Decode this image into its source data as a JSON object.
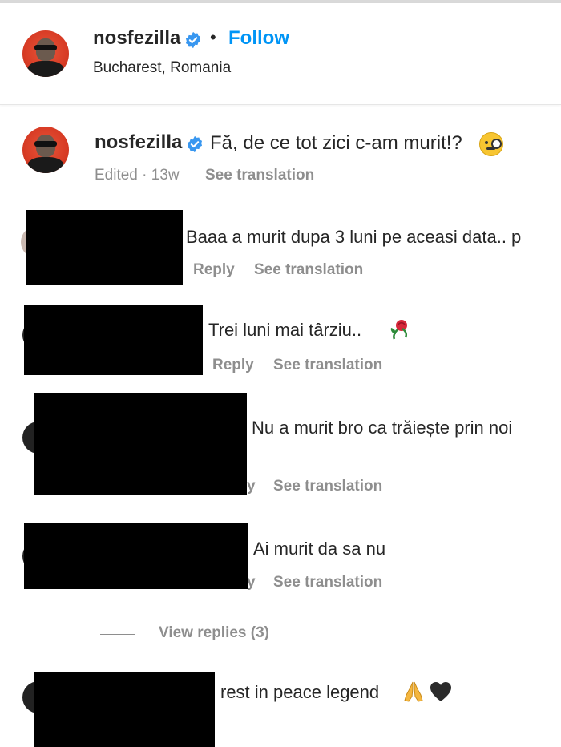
{
  "header": {
    "username": "nosfezilla",
    "separator": "•",
    "follow_label": "Follow",
    "location": "Bucharest, Romania"
  },
  "caption": {
    "username": "nosfezilla",
    "text": "Fă, de ce tot zici c-am murit!?",
    "edited_time": "Edited · 13w",
    "see_translation": "See translation",
    "emoji": "face-with-monocle-icon"
  },
  "comments": [
    {
      "text": "Baaa a murit dupa 3 luni pe aceasi data.. p",
      "reply_label": "Reply",
      "see_translation": "See translation"
    },
    {
      "text": "Trei luni mai târziu..",
      "reply_label": "Reply",
      "see_translation": "See translation",
      "emoji": "rose-icon"
    },
    {
      "text": "Nu a murit bro ca trăiește prin noi",
      "reply_label": "y",
      "see_translation": "See translation"
    },
    {
      "text": "Ai murit da sa nu",
      "reply_label": "y",
      "see_translation": "See translation"
    },
    {
      "text": "rest in peace legend",
      "emoji": [
        "folded-hands-icon",
        "black-heart-icon"
      ]
    }
  ],
  "view_replies": {
    "label": "View replies (3)"
  },
  "colors": {
    "follow": "#0095f6",
    "verified": "#3897f0",
    "meta": "#8e8e8e",
    "text": "#262626"
  }
}
